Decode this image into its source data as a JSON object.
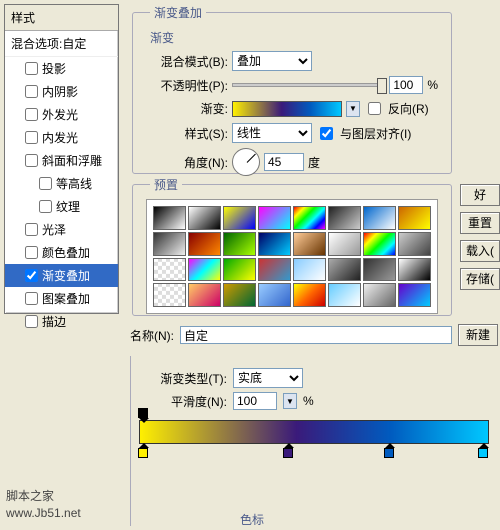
{
  "left": {
    "header": "样式",
    "blend": "混合选项:自定",
    "items": [
      {
        "l": "投影",
        "c": false
      },
      {
        "l": "内阴影",
        "c": false
      },
      {
        "l": "外发光",
        "c": false
      },
      {
        "l": "内发光",
        "c": false
      },
      {
        "l": "斜面和浮雕",
        "c": false
      },
      {
        "l": "等高线",
        "c": false,
        "i": true
      },
      {
        "l": "纹理",
        "c": false,
        "i": true
      },
      {
        "l": "光泽",
        "c": false
      },
      {
        "l": "颜色叠加",
        "c": false
      },
      {
        "l": "渐变叠加",
        "c": true,
        "s": true
      },
      {
        "l": "图案叠加",
        "c": false
      },
      {
        "l": "描边",
        "c": false
      }
    ]
  },
  "grad": {
    "title": "渐变叠加",
    "sub": "渐变",
    "blend_l": "混合模式(B):",
    "blend_v": "叠加",
    "opac_l": "不透明性(P):",
    "opac_v": "100",
    "pct": "%",
    "grad_l": "渐变:",
    "reverse": "反向(R)",
    "style_l": "样式(S):",
    "style_v": "线性",
    "align": "与图层对齐(I)",
    "angle_l": "角度(N):",
    "angle_v": "45",
    "deg": "度"
  },
  "presets": {
    "title": "预置"
  },
  "btns": {
    "ok": "好",
    "reset": "重置",
    "load": "载入(",
    "save": "存储(",
    "new": "新建"
  },
  "name": {
    "l": "名称(N):",
    "v": "自定"
  },
  "gtype": {
    "type_l": "渐变类型(T):",
    "type_v": "实底",
    "smooth_l": "平滑度(N):",
    "smooth_v": "100",
    "pct": "%"
  },
  "wm": {
    "l1": "脚本之家",
    "l2": "www.Jb51.net"
  },
  "clabel": "色标"
}
